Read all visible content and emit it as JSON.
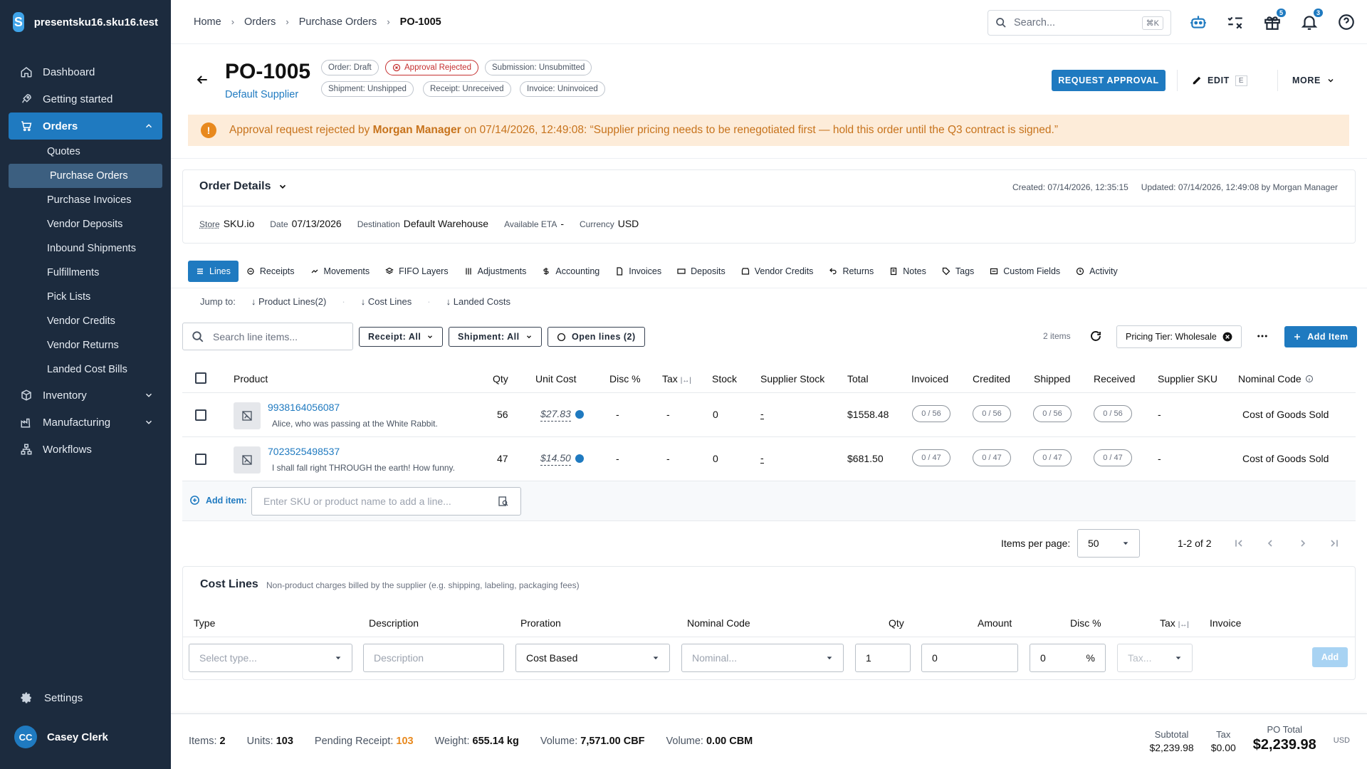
{
  "sidebar": {
    "app_name": "presentsku16.sku16.test",
    "logo_letter": "S",
    "items": [
      {
        "label": "Dashboard"
      },
      {
        "label": "Getting started"
      },
      {
        "label": "Orders"
      },
      {
        "label": "Inventory"
      },
      {
        "label": "Manufacturing"
      },
      {
        "label": "Workflows"
      }
    ],
    "orders_sub": [
      "Quotes",
      "Purchase Orders",
      "Purchase Invoices",
      "Vendor Deposits",
      "Inbound Shipments",
      "Fulfillments",
      "Pick Lists",
      "Vendor Credits",
      "Vendor Returns",
      "Landed Cost Bills"
    ],
    "settings_label": "Settings",
    "user_initials": "CC",
    "user_name": "Casey Clerk"
  },
  "topbar": {
    "breadcrumbs": [
      "Home",
      "Orders",
      "Purchase Orders",
      "PO-1005"
    ],
    "search_placeholder": "Search...",
    "search_shortcut": "⌘K",
    "gift_badge": "5",
    "bell_badge": "3"
  },
  "header": {
    "title": "PO-1005",
    "supplier": "Default Supplier",
    "chips": {
      "order": "Order: Draft",
      "approval": "Approval Rejected",
      "submission": "Submission: Unsubmitted",
      "shipment": "Shipment: Unshipped",
      "receipt": "Receipt: Unreceived",
      "invoice": "Invoice: Uninvoiced"
    },
    "request_approval": "REQUEST APPROVAL",
    "edit": "EDIT",
    "edit_key": "E",
    "more": "MORE"
  },
  "alert": {
    "prefix": "Approval request rejected by ",
    "who": "Morgan Manager",
    "message": " on 07/14/2026, 12:49:08: “Supplier pricing needs to be renegotiated first — hold this order until the Q3 contract is signed.”"
  },
  "order_details": {
    "title": "Order Details",
    "created": "Created: 07/14/2026, 12:35:15",
    "updated": "Updated: 07/14/2026, 12:49:08 by Morgan Manager",
    "fields": {
      "store_label": "Store",
      "store": "SKU.io",
      "date_label": "Date",
      "date": "07/13/2026",
      "dest_label": "Destination",
      "dest": "Default Warehouse",
      "eta_label": "Available ETA",
      "eta": "-",
      "currency_label": "Currency",
      "currency": "USD"
    }
  },
  "tabs": [
    "Lines",
    "Receipts",
    "Movements",
    "FIFO Layers",
    "Adjustments",
    "Accounting",
    "Invoices",
    "Deposits",
    "Vendor Credits",
    "Returns",
    "Notes",
    "Tags",
    "Custom Fields",
    "Activity"
  ],
  "jump": {
    "label": "Jump to:",
    "links": [
      "Product Lines(2)",
      "Cost Lines",
      "Landed Costs"
    ]
  },
  "line_toolbar": {
    "search_placeholder": "Search line items...",
    "receipt_filter": "Receipt: All",
    "shipment_filter": "Shipment: All",
    "open_lines": "Open lines (2)",
    "items_count": "2 items",
    "pricing_tier": "Pricing Tier: Wholesale",
    "add_item": "Add Item"
  },
  "lines_table": {
    "headers": {
      "product": "Product",
      "qty": "Qty",
      "unit_cost": "Unit Cost",
      "disc": "Disc %",
      "tax": "Tax",
      "stock": "Stock",
      "supplier_stock": "Supplier Stock",
      "total": "Total",
      "invoiced": "Invoiced",
      "credited": "Credited",
      "shipped": "Shipped",
      "received": "Received",
      "supplier_sku": "Supplier SKU",
      "nominal": "Nominal Code"
    },
    "rows": [
      {
        "sku": "9938164056087",
        "desc": "Alice, who was passing at the White Rabbit.",
        "qty": "56",
        "unit_cost": "$27.83",
        "disc": "-",
        "tax": "-",
        "stock": "0",
        "supplier_stock": "-",
        "total": "$1558.48",
        "invoiced": "0 / 56",
        "credited": "0 / 56",
        "shipped": "0 / 56",
        "received": "0 / 56",
        "supplier_sku": "-",
        "nominal": "Cost of Goods Sold"
      },
      {
        "sku": "7023525498537",
        "desc": "I shall fall right THROUGH the earth! How funny.",
        "qty": "47",
        "unit_cost": "$14.50",
        "disc": "-",
        "tax": "-",
        "stock": "0",
        "supplier_stock": "-",
        "total": "$681.50",
        "invoiced": "0 / 47",
        "credited": "0 / 47",
        "shipped": "0 / 47",
        "received": "0 / 47",
        "supplier_sku": "-",
        "nominal": "Cost of Goods Sold"
      }
    ],
    "add_label": "Add item:",
    "add_placeholder": "Enter SKU or product name to add a line..."
  },
  "pager": {
    "label": "Items per page:",
    "per_page": "50",
    "range": "1-2 of 2"
  },
  "cost_lines": {
    "title": "Cost Lines",
    "subtitle": "Non-product charges billed by the supplier (e.g. shipping, labeling, packaging fees)",
    "headers": {
      "type": "Type",
      "description": "Description",
      "proration": "Proration",
      "nominal": "Nominal Code",
      "qty": "Qty",
      "amount": "Amount",
      "disc": "Disc %",
      "tax": "Tax",
      "invoice": "Invoice"
    },
    "type_placeholder": "Select type...",
    "desc_placeholder": "Description",
    "proration_value": "Cost Based",
    "nominal_placeholder": "Nominal...",
    "qty_value": "1",
    "amount_value": "0",
    "disc_value": "0",
    "percent": "%",
    "tax_placeholder": "Tax...",
    "add": "Add"
  },
  "footer": {
    "items_label": "Items:",
    "items": "2",
    "units_label": "Units:",
    "units": "103",
    "pending_label": "Pending Receipt:",
    "pending": "103",
    "weight_label": "Weight:",
    "weight": "655.14 kg",
    "volume1_label": "Volume:",
    "volume1": "7,571.00 CBF",
    "volume2_label": "Volume:",
    "volume2": "0.00 CBM",
    "subtotal_label": "Subtotal",
    "subtotal": "$2,239.98",
    "tax_label": "Tax",
    "tax": "$0.00",
    "total_label": "PO Total",
    "total": "$2,239.98",
    "currency": "USD"
  },
  "colors": {
    "accent": "#1f7ac0",
    "sidebar_bg": "#1c2b3e",
    "alert_bg": "#fdecd9",
    "alert_text": "#c7731c",
    "rejected": "#c53030"
  }
}
